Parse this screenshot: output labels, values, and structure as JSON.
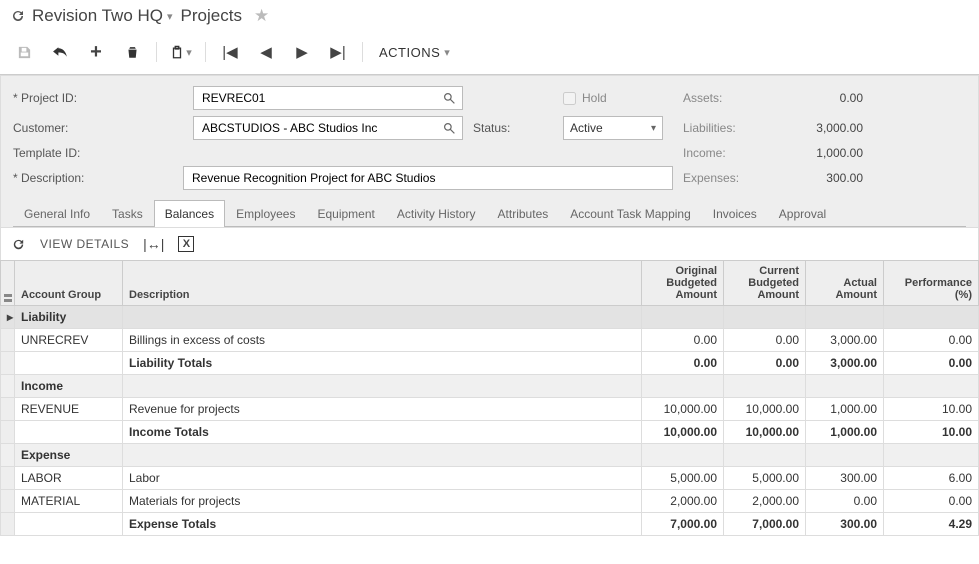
{
  "header": {
    "company": "Revision Two HQ",
    "page": "Projects"
  },
  "toolbar": {
    "actions_label": "ACTIONS"
  },
  "form": {
    "project_id_label": "Project ID:",
    "project_id": "REVREC01",
    "customer_label": "Customer:",
    "customer": "ABCSTUDIOS - ABC Studios Inc",
    "template_label": "Template ID:",
    "template": "",
    "description_label": "Description:",
    "description": "Revenue Recognition Project for ABC Studios",
    "hold_label": "Hold",
    "hold_checked": false,
    "status_label": "Status:",
    "status_value": "Active",
    "summary": {
      "assets_label": "Assets:",
      "assets": "0.00",
      "liabilities_label": "Liabilities:",
      "liabilities": "3,000.00",
      "income_label": "Income:",
      "income": "1,000.00",
      "expenses_label": "Expenses:",
      "expenses": "300.00"
    }
  },
  "tabs": [
    "General Info",
    "Tasks",
    "Balances",
    "Employees",
    "Equipment",
    "Activity History",
    "Attributes",
    "Account Task Mapping",
    "Invoices",
    "Approval"
  ],
  "active_tab": "Balances",
  "grid_toolbar": {
    "view_details": "VIEW DETAILS"
  },
  "grid": {
    "headers": {
      "account_group": "Account Group",
      "description": "Description",
      "original": "Original Budgeted Amount",
      "current": "Current Budgeted Amount",
      "actual": "Actual Amount",
      "performance": "Performance (%)"
    },
    "rows": [
      {
        "type": "group",
        "selected": true,
        "ptr": "▸",
        "account": "Liability",
        "desc": "",
        "orig": "",
        "curr": "",
        "actual": "",
        "perf": ""
      },
      {
        "type": "data",
        "account": "UNRECREV",
        "desc": "Billings in excess of costs",
        "orig": "0.00",
        "curr": "0.00",
        "actual": "3,000.00",
        "perf": "0.00"
      },
      {
        "type": "total",
        "account": "",
        "desc": "Liability Totals",
        "orig": "0.00",
        "curr": "0.00",
        "actual": "3,000.00",
        "perf": "0.00"
      },
      {
        "type": "group",
        "account": "Income",
        "desc": "",
        "orig": "",
        "curr": "",
        "actual": "",
        "perf": ""
      },
      {
        "type": "data",
        "account": "REVENUE",
        "desc": "Revenue for projects",
        "orig": "10,000.00",
        "curr": "10,000.00",
        "actual": "1,000.00",
        "perf": "10.00"
      },
      {
        "type": "total",
        "account": "",
        "desc": "Income Totals",
        "orig": "10,000.00",
        "curr": "10,000.00",
        "actual": "1,000.00",
        "perf": "10.00"
      },
      {
        "type": "group",
        "account": "Expense",
        "desc": "",
        "orig": "",
        "curr": "",
        "actual": "",
        "perf": ""
      },
      {
        "type": "data",
        "account": "LABOR",
        "desc": "Labor",
        "orig": "5,000.00",
        "curr": "5,000.00",
        "actual": "300.00",
        "perf": "6.00"
      },
      {
        "type": "data",
        "account": "MATERIAL",
        "desc": "Materials for projects",
        "orig": "2,000.00",
        "curr": "2,000.00",
        "actual": "0.00",
        "perf": "0.00"
      },
      {
        "type": "total",
        "account": "",
        "desc": "Expense Totals",
        "orig": "7,000.00",
        "curr": "7,000.00",
        "actual": "300.00",
        "perf": "4.29"
      }
    ]
  }
}
